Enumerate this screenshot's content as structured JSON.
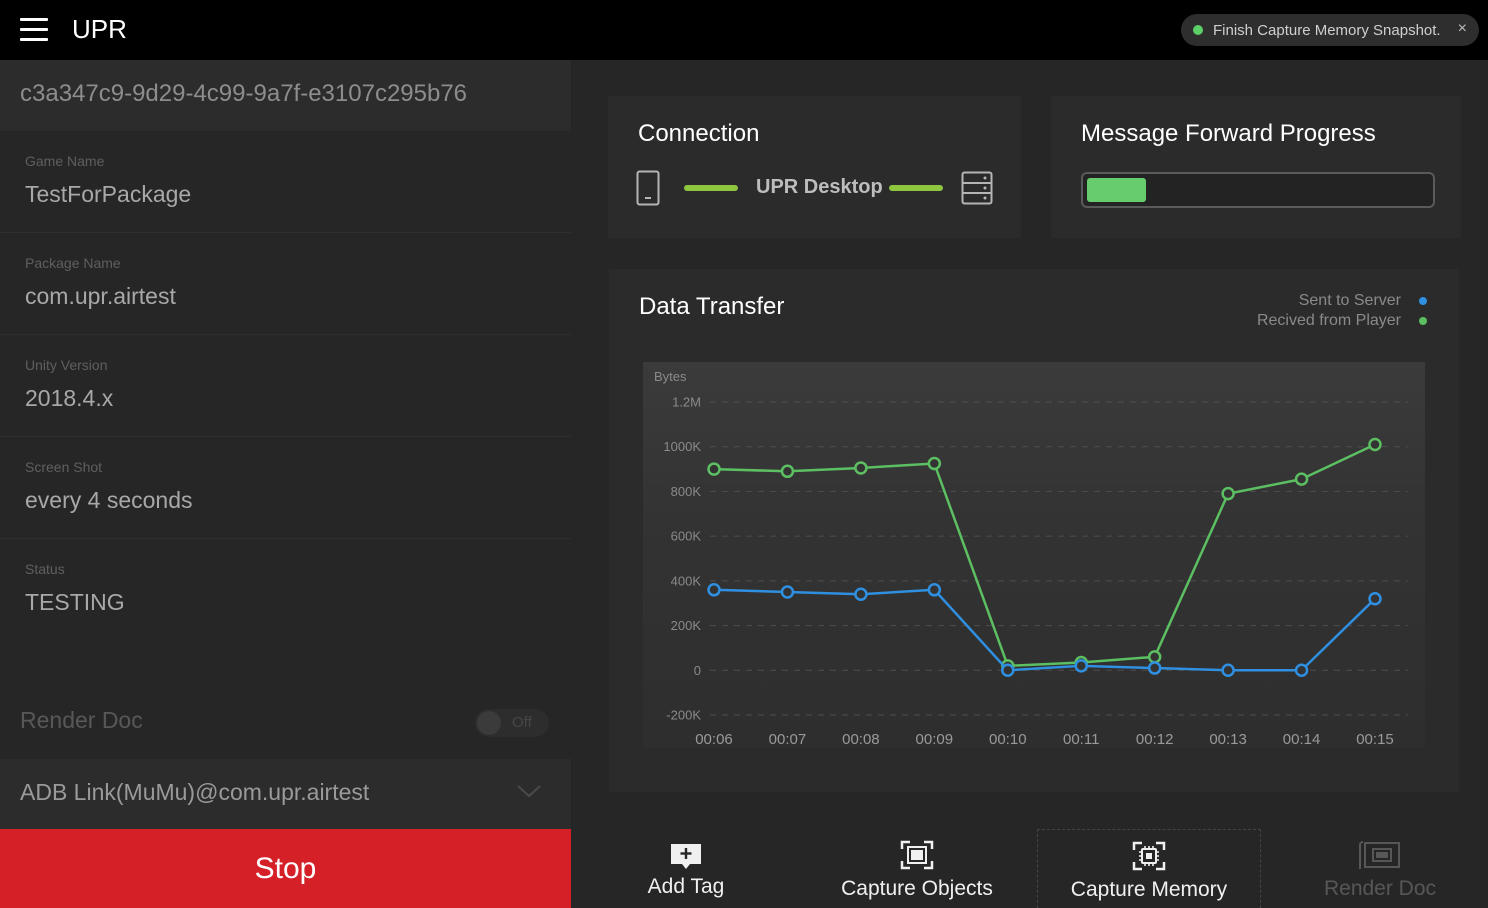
{
  "header": {
    "title": "UPR",
    "toast": {
      "text": "Finish Capture Memory Snapshot.",
      "close": "×",
      "status_color": "#5ccf66"
    }
  },
  "sidebar": {
    "session_id": "c3a347c9-9d29-4c99-9a7f-e3107c295b76",
    "fields": [
      {
        "label": "Game Name",
        "value": "TestForPackage"
      },
      {
        "label": "Package Name",
        "value": "com.upr.airtest"
      },
      {
        "label": "Unity Version",
        "value": "2018.4.x"
      },
      {
        "label": "Screen Shot",
        "value": "every 4 seconds"
      },
      {
        "label": "Status",
        "value": "TESTING"
      }
    ],
    "render_doc": {
      "label": "Render Doc",
      "toggle_text": "Off",
      "enabled": false
    },
    "device_select": {
      "value": "ADB Link(MuMu)@com.upr.airtest"
    },
    "stop_label": "Stop",
    "stop_color": "#d62027"
  },
  "connection": {
    "title": "Connection",
    "label": "UPR Desktop",
    "line_color": "#8fc63f"
  },
  "forward_progress": {
    "title": "Message Forward Progress",
    "fraction": 0.17,
    "fill_color": "#66cc6e"
  },
  "data_transfer": {
    "title": "Data Transfer",
    "legend": [
      {
        "name": "Sent to Server",
        "color": "#2f8fe0"
      },
      {
        "name": "Recived from Player",
        "color": "#5cbf62"
      }
    ]
  },
  "chart_data": {
    "type": "line",
    "title": "Data Transfer",
    "ylabel": "Bytes",
    "xlabel": "",
    "ylim": [
      -200000,
      1200000
    ],
    "yticks": [
      {
        "v": 1200000,
        "label": "1.2M"
      },
      {
        "v": 1000000,
        "label": "1000K"
      },
      {
        "v": 800000,
        "label": "800K"
      },
      {
        "v": 600000,
        "label": "600K"
      },
      {
        "v": 400000,
        "label": "400K"
      },
      {
        "v": 200000,
        "label": "200K"
      },
      {
        "v": 0,
        "label": "0"
      },
      {
        "v": -200000,
        "label": "-200K"
      }
    ],
    "grid": true,
    "legend_position": "top-right",
    "categories": [
      "00:06",
      "00:07",
      "00:08",
      "00:09",
      "00:10",
      "00:11",
      "00:12",
      "00:13",
      "00:14",
      "00:15"
    ],
    "series": [
      {
        "name": "Sent to Server",
        "color": "#2f8fe0",
        "values": [
          360000,
          350000,
          340000,
          360000,
          0,
          20000,
          10000,
          0,
          0,
          320000
        ]
      },
      {
        "name": "Recived from Player",
        "color": "#5cbf62",
        "values": [
          900000,
          890000,
          905000,
          925000,
          20000,
          35000,
          60000,
          790000,
          855000,
          1010000
        ]
      }
    ]
  },
  "toolbar": {
    "buttons": [
      {
        "id": "add-tag",
        "label": "Add Tag",
        "icon": "tag-plus-icon"
      },
      {
        "id": "capture-objects",
        "label": "Capture Objects",
        "icon": "capture-frame-icon"
      },
      {
        "id": "capture-memory",
        "label": "Capture Memory",
        "icon": "memory-chip-icon"
      },
      {
        "id": "render-doc",
        "label": "Render Doc",
        "icon": "render-doc-icon"
      }
    ]
  }
}
